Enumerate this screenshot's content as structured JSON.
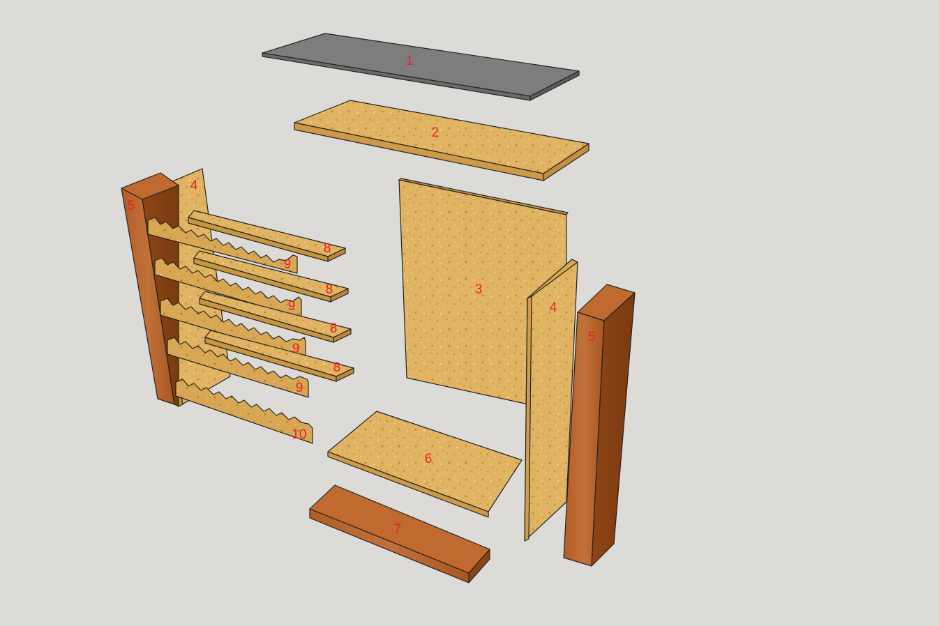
{
  "colors": {
    "background": "#dcdbd8",
    "label": "#e8202a",
    "glass_top": "#7d7d7d",
    "glass_edge": "#6a6a6a",
    "particle_board": "#e0b462",
    "particle_board_edge": "#c8963e",
    "hardwood": "#b8642a",
    "hardwood_dark": "#8f4716",
    "hardwood_light": "#c67a3c"
  },
  "parts": [
    {
      "id": "glass-top",
      "label": "1"
    },
    {
      "id": "top-panel",
      "label": "2"
    },
    {
      "id": "back-panel",
      "label": "3"
    },
    {
      "id": "left-side-panel",
      "label": "4"
    },
    {
      "id": "right-side-panel",
      "label": "4"
    },
    {
      "id": "left-front-post",
      "label": "5"
    },
    {
      "id": "right-front-post",
      "label": "5"
    },
    {
      "id": "bottom-panel",
      "label": "6"
    },
    {
      "id": "base-rail",
      "label": "7"
    },
    {
      "id": "shelf-1",
      "label": "8"
    },
    {
      "id": "shelf-2",
      "label": "8"
    },
    {
      "id": "shelf-3",
      "label": "8"
    },
    {
      "id": "shelf-4",
      "label": "8"
    },
    {
      "id": "notched-rail-1",
      "label": "9"
    },
    {
      "id": "notched-rail-2",
      "label": "9"
    },
    {
      "id": "notched-rail-3",
      "label": "9"
    },
    {
      "id": "notched-rail-4",
      "label": "9"
    },
    {
      "id": "bottom-notched-rail",
      "label": "10"
    }
  ]
}
